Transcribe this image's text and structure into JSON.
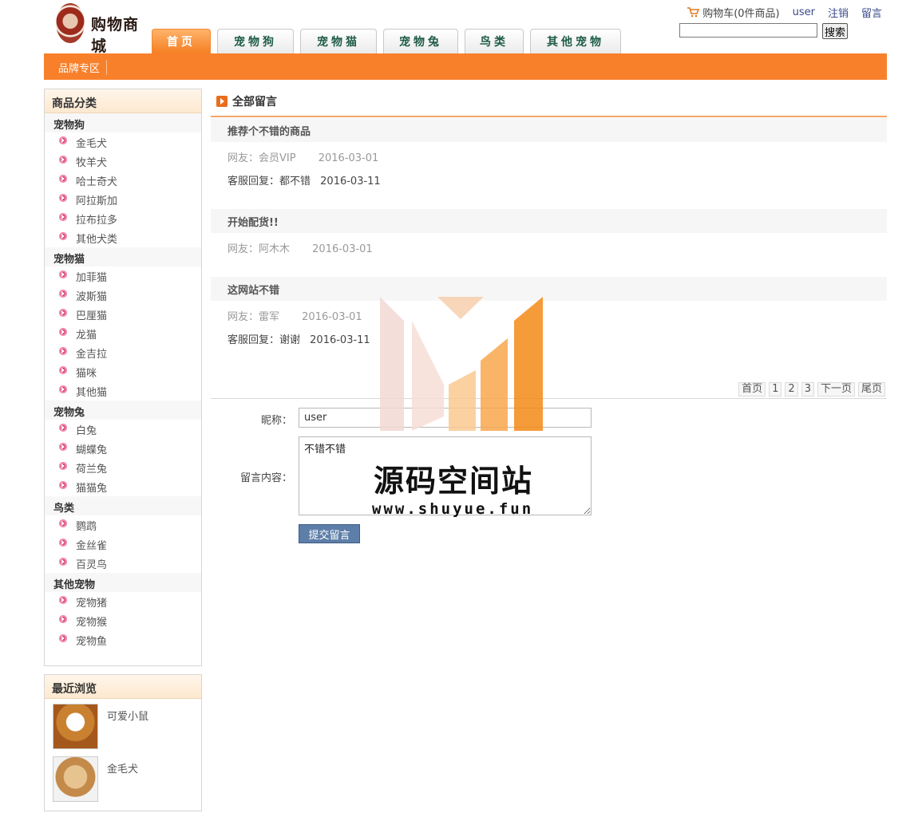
{
  "header": {
    "logo_text": "购物商城",
    "cart_label": "购物车(0件商品)",
    "user_label": "user",
    "logout_label": "注销",
    "message_label": "留言",
    "search_value": "",
    "search_button": "搜索"
  },
  "nav": {
    "tabs": [
      {
        "label": "首页",
        "active": true
      },
      {
        "label": "宠物狗",
        "active": false
      },
      {
        "label": "宠物猫",
        "active": false
      },
      {
        "label": "宠物兔",
        "active": false
      },
      {
        "label": "鸟类",
        "active": false
      },
      {
        "label": "其他宠物",
        "active": false
      }
    ],
    "brand_zone": "品牌专区"
  },
  "sidebar": {
    "category_title": "商品分类",
    "categories": [
      {
        "name": "宠物狗",
        "items": [
          "金毛犬",
          "牧羊犬",
          "哈士奇犬",
          "阿拉斯加",
          "拉布拉多",
          "其他犬类"
        ]
      },
      {
        "name": "宠物猫",
        "items": [
          "加菲猫",
          "波斯猫",
          "巴厘猫",
          "龙猫",
          "金吉拉",
          "猫咪",
          "其他猫"
        ]
      },
      {
        "name": "宠物兔",
        "items": [
          "白兔",
          "蝴蝶兔",
          "荷兰兔",
          "猫猫兔"
        ]
      },
      {
        "name": "鸟类",
        "items": [
          "鹦鹉",
          "金丝雀",
          "百灵鸟"
        ]
      },
      {
        "name": "其他宠物",
        "items": [
          "宠物猪",
          "宠物猴",
          "宠物鱼"
        ]
      }
    ],
    "recent_title": "最近浏览",
    "recent": [
      {
        "name": "可爱小鼠",
        "image": "guinea-pig"
      },
      {
        "name": "金毛犬",
        "image": "dog"
      }
    ]
  },
  "main": {
    "title": "全部留言",
    "messages": [
      {
        "subject": "推荐个不错的商品",
        "author": "网友：会员VIP",
        "date": "2016-03-01",
        "reply_label": "客服回复：都不错",
        "reply_date": "2016-03-11"
      },
      {
        "subject": "开始配货!!",
        "author": "网友：阿木木",
        "date": "2016-03-01",
        "reply_label": "",
        "reply_date": ""
      },
      {
        "subject": "这网站不错",
        "author": "网友：雷军",
        "date": "2016-03-01",
        "reply_label": "客服回复：谢谢",
        "reply_date": "2016-03-11"
      }
    ],
    "pager": [
      "首页",
      "1",
      "2",
      "3",
      "下一页",
      "尾页"
    ],
    "form": {
      "nick_label": "昵称：",
      "nick_value": "user",
      "content_label": "留言内容：",
      "content_value": "不错不错",
      "submit": "提交留言"
    }
  },
  "watermark": {
    "title": "源码空间站",
    "url": "www.shuyue.fun"
  },
  "colors": {
    "accent": "#f8802b",
    "nav_text": "#1e5c46",
    "link": "#3a4b8c",
    "submit": "#5d7ea8"
  }
}
